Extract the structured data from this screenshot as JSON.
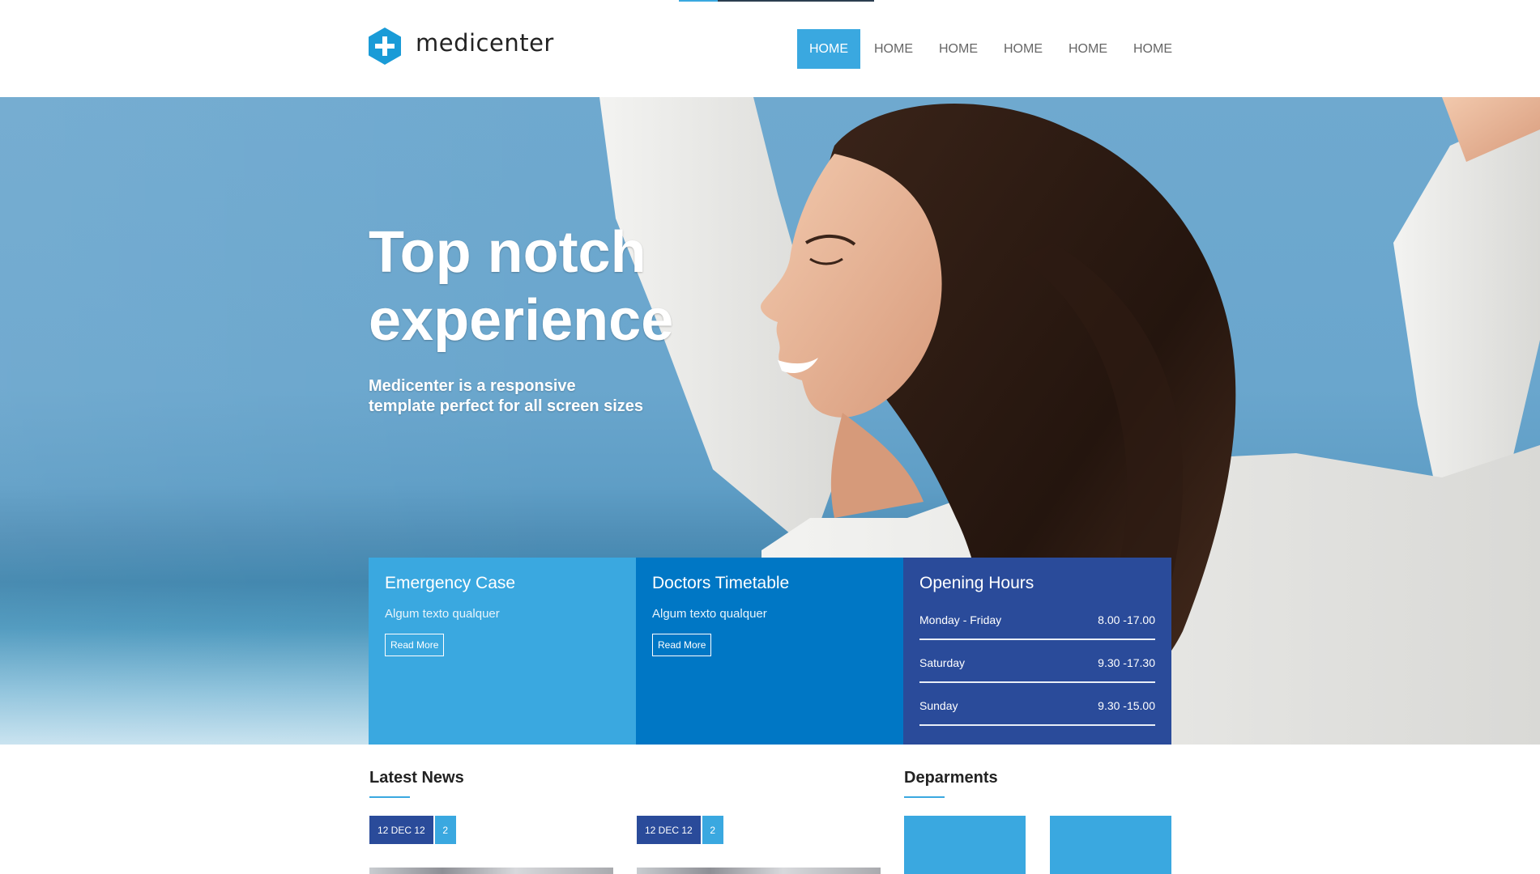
{
  "brand": {
    "name": "medicenter",
    "color_primary": "#3aa8e0",
    "color_dark": "#2a4b9a",
    "color_mid": "#0077c5"
  },
  "nav": {
    "items": [
      {
        "label": "HOME",
        "active": true
      },
      {
        "label": "HOME",
        "active": false
      },
      {
        "label": "HOME",
        "active": false
      },
      {
        "label": "HOME",
        "active": false
      },
      {
        "label": "HOME",
        "active": false
      },
      {
        "label": "HOME",
        "active": false
      }
    ]
  },
  "hero": {
    "title": "Top notch experience",
    "subtitle": "Medicenter is a responsive template perfect for all screen sizes"
  },
  "boxes": {
    "emergency": {
      "title": "Emergency Case",
      "text": "Algum texto qualquer",
      "button": "Read More"
    },
    "timetable": {
      "title": "Doctors Timetable",
      "text": "Algum texto qualquer",
      "button": "Read More"
    },
    "hours": {
      "title": "Opening Hours",
      "rows": [
        {
          "day": "Monday - Friday",
          "time": "8.00 -17.00"
        },
        {
          "day": "Saturday",
          "time": "9.30 -17.30"
        },
        {
          "day": "Sunday",
          "time": "9.30 -15.00"
        }
      ]
    }
  },
  "latest_news": {
    "title": "Latest News",
    "posts": [
      {
        "date": "12 DEC 12",
        "comments": "2"
      },
      {
        "date": "12 DEC 12",
        "comments": "2"
      }
    ]
  },
  "departments": {
    "title": "Deparments"
  }
}
